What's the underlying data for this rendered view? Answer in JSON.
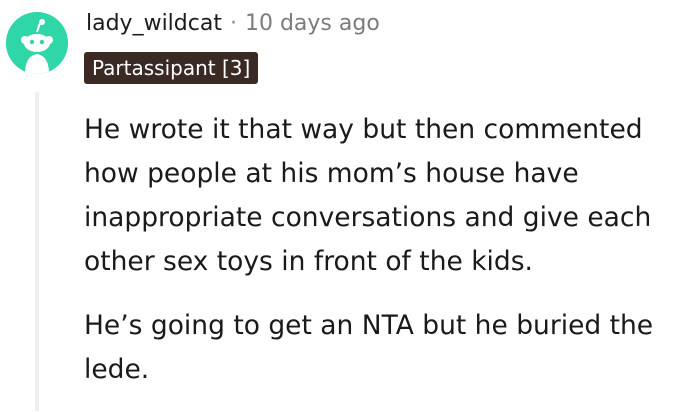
{
  "comment": {
    "author": "lady_wildcat",
    "separator": "·",
    "timestamp": "10 days ago",
    "flair": "Partassipant [3]",
    "paragraphs": [
      "He wrote it that way but then commented how people at his mom’s house have inappropriate conversations and give each other sex toys in front of the kids.",
      "He’s going to get an NTA but he buried the lede."
    ]
  },
  "colors": {
    "avatar_bg": "#2fd6a7",
    "flair_bg": "#3b2a24",
    "thread_line": "#edeff1",
    "text": "#1a1a1b",
    "meta": "#7c7c7c"
  },
  "icons": {
    "avatar": "snoo-avatar-icon"
  }
}
